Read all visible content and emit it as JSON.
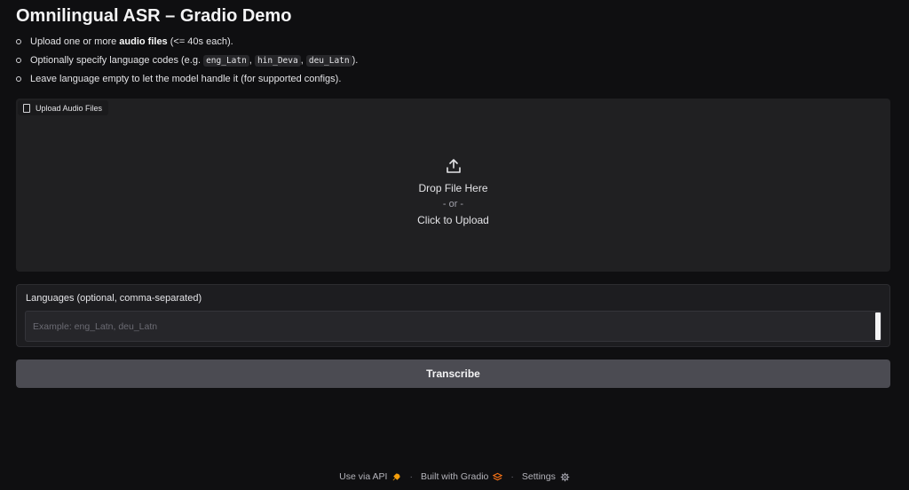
{
  "page": {
    "title": "Omnilingual ASR – Gradio Demo"
  },
  "instructions": {
    "item1": {
      "before": "Upload one or more ",
      "bold": "audio files",
      "after": " (<= 40s each)."
    },
    "item2": {
      "before": "Optionally specify language codes (e.g. ",
      "code1": "eng_Latn",
      "sep1": ", ",
      "code2": "hin_Deva",
      "sep2": ", ",
      "code3": "deu_Latn",
      "after": ")."
    },
    "item3": {
      "text": "Leave language empty to let the model handle it (for supported configs)."
    }
  },
  "upload": {
    "label": "Upload Audio Files",
    "drop_text": "Drop File Here",
    "or_text": "- or -",
    "click_text": "Click to Upload",
    "icon": "upload-icon"
  },
  "languages": {
    "label": "Languages (optional, comma-separated)",
    "value": "",
    "placeholder": "Example: eng_Latn, deu_Latn"
  },
  "actions": {
    "transcribe_label": "Transcribe"
  },
  "footer": {
    "api_label": "Use via API",
    "built_label": "Built with Gradio",
    "settings_label": "Settings",
    "separator": "·"
  },
  "colors": {
    "background": "#0f0f11",
    "panel": "#202022",
    "button": "#4b4b52",
    "gradio_orange": "#f97316"
  }
}
